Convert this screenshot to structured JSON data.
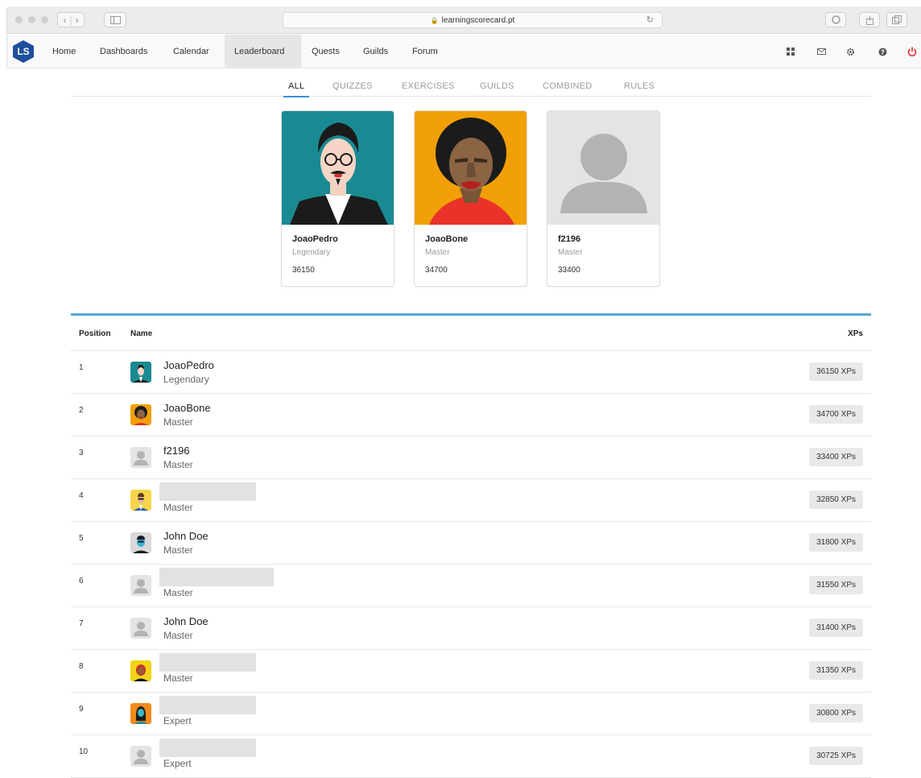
{
  "browser": {
    "url": "learningscorecard.pt"
  },
  "nav": {
    "logo": "LS",
    "items": [
      {
        "label": "Home"
      },
      {
        "label": "Dashboards"
      },
      {
        "label": "Calendar"
      },
      {
        "label": "Leaderboard",
        "active": true
      },
      {
        "label": "Quests"
      },
      {
        "label": "Guilds"
      },
      {
        "label": "Forum"
      }
    ],
    "icons": [
      "grid-icon",
      "mail-icon",
      "gear-icon",
      "help-icon",
      "power-icon"
    ]
  },
  "tabs": [
    {
      "label": "ALL",
      "active": true
    },
    {
      "label": "QUIZZES"
    },
    {
      "label": "EXERCISES"
    },
    {
      "label": "GUILDS"
    },
    {
      "label": "COMBINED"
    },
    {
      "label": "RULES"
    }
  ],
  "podium": [
    {
      "name": "JoaoPedro",
      "rank": "Legendary",
      "points": "36150",
      "avatar": "avatar-teal-man"
    },
    {
      "name": "JoaoBone",
      "rank": "Master",
      "points": "34700",
      "avatar": "avatar-orange-man"
    },
    {
      "name": "f2196",
      "rank": "Master",
      "points": "33400",
      "avatar": "avatar-placeholder"
    }
  ],
  "table": {
    "headers": {
      "position": "Position",
      "name": "Name",
      "xps": "XPs"
    },
    "rows": [
      {
        "position": "1",
        "name": "JoaoPedro",
        "rank": "Legendary",
        "xp": "36150 XPs",
        "avatar": "teal"
      },
      {
        "position": "2",
        "name": "JoaoBone",
        "rank": "Master",
        "xp": "34700 XPs",
        "avatar": "orange"
      },
      {
        "position": "3",
        "name": "f2196",
        "rank": "Master",
        "xp": "33400 XPs",
        "avatar": "placeholder"
      },
      {
        "position": "4",
        "name": "",
        "rank": "Master",
        "xp": "32850 XPs",
        "avatar": "yellow",
        "redacted": true
      },
      {
        "position": "5",
        "name": "John Doe",
        "rank": "Master",
        "xp": "31800 XPs",
        "avatar": "blue"
      },
      {
        "position": "6",
        "name": "",
        "rank": "Master",
        "xp": "31550 XPs",
        "avatar": "placeholder",
        "redacted": true
      },
      {
        "position": "7",
        "name": "John Doe",
        "rank": "Master",
        "xp": "31400 XPs",
        "avatar": "placeholder"
      },
      {
        "position": "8",
        "name": "",
        "rank": "Master",
        "xp": "31350 XPs",
        "avatar": "yellow-red",
        "redacted": true
      },
      {
        "position": "9",
        "name": "",
        "rank": "Expert",
        "xp": "30800 XPs",
        "avatar": "orange-woman",
        "redacted": true
      },
      {
        "position": "10",
        "name": "",
        "rank": "Expert",
        "xp": "30725 XPs",
        "avatar": "placeholder",
        "redacted": true
      }
    ]
  },
  "colors": {
    "accent": "#3d8ed6",
    "tableTop": "#5ba6d6",
    "logo": "#1e4f9c",
    "power": "#e0302a"
  }
}
